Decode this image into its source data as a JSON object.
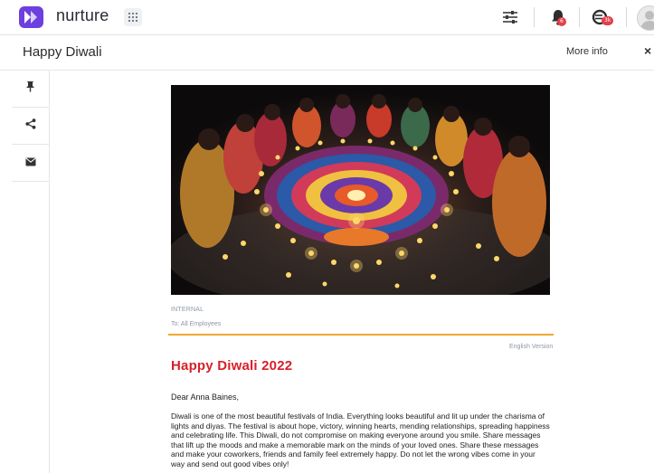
{
  "app": {
    "brand": "nurture",
    "colors": {
      "brand_purple": "#6d3fe0",
      "notification_red": "#e0404a",
      "accent_orange": "#f0a830",
      "headline_red": "#d8202a"
    }
  },
  "topbar": {
    "icons": [
      "grid-icon",
      "filter-sliders-icon",
      "bell-icon",
      "coin-icon",
      "avatar"
    ],
    "bell_badge": "6",
    "coin_badge": "3k"
  },
  "titlebar": {
    "title": "Happy Diwali",
    "more_info": "More info",
    "close": "×"
  },
  "rail": {
    "items": [
      "pin-icon",
      "share-icon",
      "mail-icon"
    ]
  },
  "post": {
    "image": "diwali-rangoli-photo",
    "tag": "INTERNAL",
    "recipients": "To: All Employees",
    "language": "English Version",
    "headline": "Happy Diwali 2022",
    "greeting": "Dear Anna Baines,",
    "body": "Diwali is one of the most beautiful festivals of India. Everything looks beautiful and lit up under the charisma of lights and diyas. The festival is about hope, victory, winning hearts, mending relationships, spreading happiness and celebrating life. This Diwali, do not compromise on making everyone around you smile. Share messages that lift up the moods and make a memorable mark on the minds of your loved ones. Share these messages and make your coworkers, friends and family feel extremely happy. Do not let the wrong vibes come in your way and send out good vibes only!"
  }
}
